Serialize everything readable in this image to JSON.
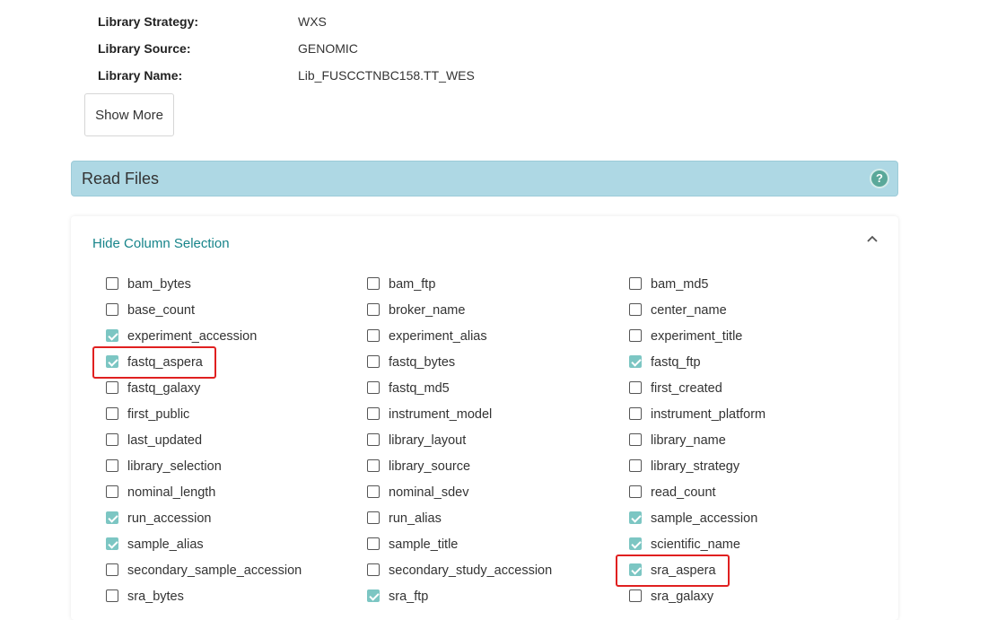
{
  "details": {
    "rows": [
      {
        "label": "Library Strategy:",
        "value": "WXS"
      },
      {
        "label": "Library Source:",
        "value": "GENOMIC"
      },
      {
        "label": "Library Name:",
        "value": "Lib_FUSCCTNBC158.TT_WES"
      }
    ],
    "show_more_label": "Show More"
  },
  "read_files": {
    "title": "Read Files",
    "help_icon_glyph": "?",
    "hide_column_selection_label": "Hide Column Selection",
    "columns": [
      [
        {
          "name": "bam_bytes",
          "checked": false
        },
        {
          "name": "base_count",
          "checked": false
        },
        {
          "name": "experiment_accession",
          "checked": true
        },
        {
          "name": "fastq_aspera",
          "checked": true,
          "highlighted": true
        },
        {
          "name": "fastq_galaxy",
          "checked": false
        },
        {
          "name": "first_public",
          "checked": false
        },
        {
          "name": "last_updated",
          "checked": false
        },
        {
          "name": "library_selection",
          "checked": false
        },
        {
          "name": "nominal_length",
          "checked": false
        },
        {
          "name": "run_accession",
          "checked": true
        },
        {
          "name": "sample_alias",
          "checked": true
        },
        {
          "name": "secondary_sample_accession",
          "checked": false
        },
        {
          "name": "sra_bytes",
          "checked": false
        }
      ],
      [
        {
          "name": "bam_ftp",
          "checked": false
        },
        {
          "name": "broker_name",
          "checked": false
        },
        {
          "name": "experiment_alias",
          "checked": false
        },
        {
          "name": "fastq_bytes",
          "checked": false
        },
        {
          "name": "fastq_md5",
          "checked": false
        },
        {
          "name": "instrument_model",
          "checked": false
        },
        {
          "name": "library_layout",
          "checked": false
        },
        {
          "name": "library_source",
          "checked": false
        },
        {
          "name": "nominal_sdev",
          "checked": false
        },
        {
          "name": "run_alias",
          "checked": false
        },
        {
          "name": "sample_title",
          "checked": false
        },
        {
          "name": "secondary_study_accession",
          "checked": false
        },
        {
          "name": "sra_ftp",
          "checked": true
        }
      ],
      [
        {
          "name": "bam_md5",
          "checked": false
        },
        {
          "name": "center_name",
          "checked": false
        },
        {
          "name": "experiment_title",
          "checked": false
        },
        {
          "name": "fastq_ftp",
          "checked": true
        },
        {
          "name": "first_created",
          "checked": false
        },
        {
          "name": "instrument_platform",
          "checked": false
        },
        {
          "name": "library_name",
          "checked": false
        },
        {
          "name": "library_strategy",
          "checked": false
        },
        {
          "name": "read_count",
          "checked": false
        },
        {
          "name": "sample_accession",
          "checked": true
        },
        {
          "name": "scientific_name",
          "checked": true
        },
        {
          "name": "sra_aspera",
          "checked": true,
          "highlighted": true
        },
        {
          "name": "sra_galaxy",
          "checked": false
        }
      ]
    ]
  },
  "colors": {
    "accent": "#17848a",
    "header_bg": "#aed8e4",
    "checkbox_checked": "#7cc6c3",
    "highlight_border": "#e02020"
  }
}
